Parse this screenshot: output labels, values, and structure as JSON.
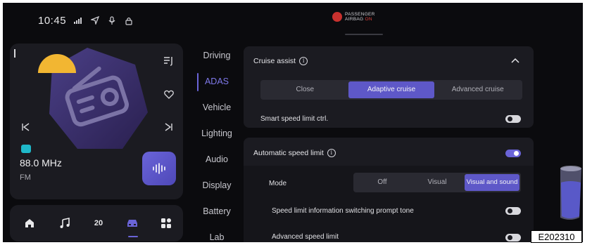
{
  "status_bar": {
    "time": "10:45",
    "icons": [
      "signal-icon",
      "location-icon",
      "microphone-icon",
      "lock-icon"
    ],
    "airbag": {
      "line1": "PASSENGER",
      "line2": "AIRBAG",
      "state": "ON",
      "icon": "airbag-off-icon"
    }
  },
  "media": {
    "frequency": "88.0 MHz",
    "band": "FM",
    "icons": [
      "queue-icon",
      "heart-icon",
      "previous-icon",
      "next-icon",
      "radio-icon",
      "play-wave-icon"
    ]
  },
  "dock": {
    "temperature": "20",
    "icons": [
      "home-icon",
      "music-icon",
      "temperature-icon",
      "car-icon",
      "apps-icon"
    ]
  },
  "nav": {
    "items": [
      "Driving",
      "ADAS",
      "Vehicle",
      "Lighting",
      "Audio",
      "Display",
      "Battery",
      "Lab"
    ],
    "active": "ADAS"
  },
  "cruise": {
    "title": "Cruise assist",
    "options": [
      "Close",
      "Adaptive cruise",
      "Advanced cruise"
    ],
    "selected": "Adaptive cruise",
    "smart_speed_label": "Smart speed limit ctrl.",
    "smart_speed_on": false
  },
  "speed_limit": {
    "title": "Automatic speed limit",
    "enabled": true,
    "mode_label": "Mode",
    "mode_options": [
      "Off",
      "Visual",
      "Visual and sound"
    ],
    "mode_selected": "Visual and sound",
    "prompt_tone_label": "Speed limit information switching prompt tone",
    "prompt_tone_on": false,
    "advanced_label": "Advanced speed limit",
    "advanced_on": false
  },
  "figure_code": "E202310",
  "colors": {
    "accent": "#6a64d8",
    "card": "#1b1b21",
    "background": "#0b0b0e",
    "airbag_on": "#e0403a"
  }
}
